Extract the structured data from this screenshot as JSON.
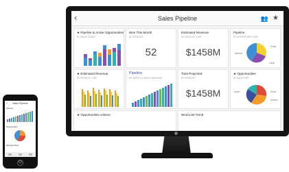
{
  "header": {
    "title": "Sales Pipeline",
    "back_icon": "chevron-left-icon",
    "people_icon": "people-icon",
    "favorite_icon": "star-icon"
  },
  "tiles": {
    "t1": {
      "title": "★ Pipeline & Active Opportunities",
      "subtitle": "BY SALES STAGE"
    },
    "t2": {
      "title": "Won This Month",
      "subtitle": "BY PRODUCT",
      "value": "52"
    },
    "t3": {
      "title": "Estimated Revenue",
      "subtitle": "BY PRODUCT LINE",
      "value": "$1458M"
    },
    "t4": {
      "title": "Pipeline",
      "subtitle": "BY OPPORTUNITY SIZE",
      "labels": [
        "Small",
        "Medium",
        "Large"
      ]
    },
    "t5": {
      "title": "★ Estimated Revenue",
      "subtitle": "BY PRODUCT LINE"
    },
    "t6": {
      "title": "Pipeline",
      "subtitle": "BY MONTH & SALES MANAGER"
    },
    "t7": {
      "title": "Total Projected",
      "subtitle": "BY PRODUCT",
      "value": "$1458M"
    },
    "t8": {
      "title": "★ Opportunities",
      "subtitle": "BY SALES REP",
      "labels": [
        "Adam",
        "Stone",
        "Andrew"
      ]
    },
    "t9": {
      "title": "★ Opportunities volume",
      "subtitle": ""
    },
    "t11": {
      "title": "Won/Lost Trend",
      "subtitle": ""
    }
  },
  "phone": {
    "title": "Sales Pipeline",
    "labels": [
      "Pipeline",
      "Opportunities",
      "Estimated Rev"
    ]
  },
  "colors": {
    "blue": "#3f8fd6",
    "purple": "#8a4fae",
    "orange": "#f39a2a",
    "teal": "#2cb5ad",
    "yellow": "#f2d22e",
    "red": "#e04a3a",
    "green": "#6fb94c",
    "navy": "#3a4fa0"
  }
}
